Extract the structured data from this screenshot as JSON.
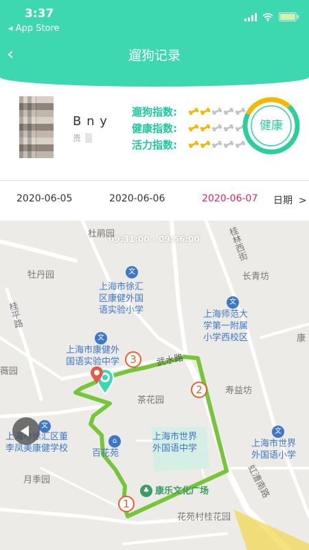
{
  "status": {
    "time": "3:37",
    "back_app": "◂ App Store"
  },
  "nav": {
    "back_icon": "‹",
    "title": "遛狗记录"
  },
  "profile": {
    "name": "B      n y",
    "sub": "贵",
    "metrics": [
      {
        "label": "遛狗指数:",
        "score": 2,
        "max": 5
      },
      {
        "label": "健康指数:",
        "score": 2,
        "max": 5
      },
      {
        "label": "活力指数:",
        "score": 2,
        "max": 5
      }
    ],
    "health": {
      "label": "健康",
      "ring_color": "#2bcf9e",
      "accent_color": "#f5b800"
    }
  },
  "dates": {
    "items": [
      "2020-06-05",
      "2020-06-06",
      "2020-06-07"
    ],
    "active_index": 2,
    "picker_label": "日期",
    "picker_icon": "chevron-right-icon"
  },
  "map": {
    "time_range": "09:31:00 - 09:56:00",
    "route_color": "#76c63a",
    "markers": [
      "1",
      "2",
      "3"
    ],
    "labels": [
      "杜鹃园",
      "牡丹园",
      "长青坊",
      "桂平路",
      "上海市徐汇\n区康健外国\n语实验小学",
      "上海师范大\n学第一附属\n小学西校区",
      "上海市康健外\n国语实验中学",
      "薇园",
      "寿益坊",
      "茶花园",
      "上海市世界\n外国语中学",
      "上海市世界\n外国语小学",
      "上海市徐汇区董\n李凤美康健学校",
      "百花苑",
      "月季园",
      "康乐文化广场",
      "花苑村桂花园",
      "虹漕南路",
      "桂林西街",
      "康",
      "武水路"
    ]
  }
}
